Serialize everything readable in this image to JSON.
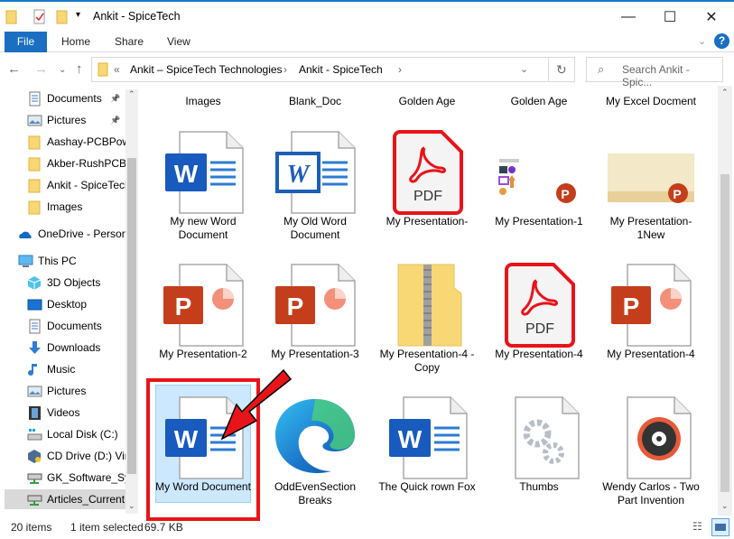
{
  "window": {
    "title": "Ankit - SpiceTech",
    "minimize": "—",
    "maximize": "☐",
    "close": "✕"
  },
  "ribbon": {
    "tabs": [
      "File",
      "Home",
      "Share",
      "View"
    ],
    "help": "?"
  },
  "address": {
    "breadcrumb": [
      "Ankit – SpiceTech Technologies",
      "Ankit - SpiceTech"
    ],
    "overflow": "«",
    "search_placeholder": "Search Ankit - Spic..."
  },
  "nav": {
    "items": [
      {
        "label": "Documents",
        "icon": "documents-icon",
        "indent": 1,
        "pinned": true
      },
      {
        "label": "Pictures",
        "icon": "pictures-icon",
        "indent": 1,
        "pinned": true
      },
      {
        "label": "Aashay-PCBPower",
        "icon": "folder-icon",
        "indent": 1
      },
      {
        "label": "Akber-RushPCB-",
        "icon": "folder-icon",
        "indent": 1
      },
      {
        "label": "Ankit - SpiceTech",
        "icon": "folder-icon",
        "indent": 1
      },
      {
        "label": "Images",
        "icon": "folder-icon",
        "indent": 1
      },
      {
        "label": "OneDrive - Personal",
        "icon": "onedrive-icon",
        "indent": 0,
        "gap": true
      },
      {
        "label": "This PC",
        "icon": "this-pc-icon",
        "indent": 0,
        "gap": true
      },
      {
        "label": "3D Objects",
        "icon": "3d-objects-icon",
        "indent": 1
      },
      {
        "label": "Desktop",
        "icon": "desktop-icon",
        "indent": 1
      },
      {
        "label": "Documents",
        "icon": "documents-icon",
        "indent": 1
      },
      {
        "label": "Downloads",
        "icon": "downloads-icon",
        "indent": 1
      },
      {
        "label": "Music",
        "icon": "music-icon",
        "indent": 1
      },
      {
        "label": "Pictures",
        "icon": "pictures-icon",
        "indent": 1
      },
      {
        "label": "Videos",
        "icon": "videos-icon",
        "indent": 1
      },
      {
        "label": "Local Disk (C:)",
        "icon": "local-disk-icon",
        "indent": 1
      },
      {
        "label": "CD Drive (D:) VirtualBox",
        "icon": "cd-drive-icon",
        "indent": 1
      },
      {
        "label": "GK_Software_System",
        "icon": "network-drive-icon",
        "indent": 1
      },
      {
        "label": "Articles_Current",
        "icon": "network-drive-icon",
        "indent": 1,
        "selected": true
      }
    ]
  },
  "files": [
    {
      "label": "Images",
      "type": "none"
    },
    {
      "label": "Blank_Doc",
      "type": "none"
    },
    {
      "label": "Golden Age",
      "type": "none"
    },
    {
      "label": "Golden Age",
      "type": "none"
    },
    {
      "label": "My Excel Docment",
      "type": "none"
    },
    {
      "label": "My new Word Document",
      "type": "word"
    },
    {
      "label": "My Old Word Document",
      "type": "word-old"
    },
    {
      "label": "My Presentation-",
      "type": "pdf"
    },
    {
      "label": "My Presentation-1",
      "type": "ppt-thumb1"
    },
    {
      "label": "My Presentation-1New",
      "type": "ppt-thumb2"
    },
    {
      "label": "My Presentation-2",
      "type": "ppt"
    },
    {
      "label": "My Presentation-3",
      "type": "ppt"
    },
    {
      "label": "My Presentation-4 - Copy",
      "type": "zip"
    },
    {
      "label": "My Presentation-4",
      "type": "pdf"
    },
    {
      "label": "My Presentation-4",
      "type": "ppt"
    },
    {
      "label": "My Word Document",
      "type": "word",
      "selected": true
    },
    {
      "label": "OddEvenSection Breaks",
      "type": "edge"
    },
    {
      "label": "The Quick  rown Fox",
      "type": "word"
    },
    {
      "label": "Thumbs",
      "type": "system"
    },
    {
      "label": "Wendy Carlos - Two Part Invention",
      "type": "audio"
    }
  ],
  "status": {
    "count": "20 items",
    "selected": "1 item selected",
    "size": "69.7 KB"
  },
  "colors": {
    "accent": "#1a6fc3",
    "selection": "#cce8ff",
    "annotation": "#e8141a"
  }
}
